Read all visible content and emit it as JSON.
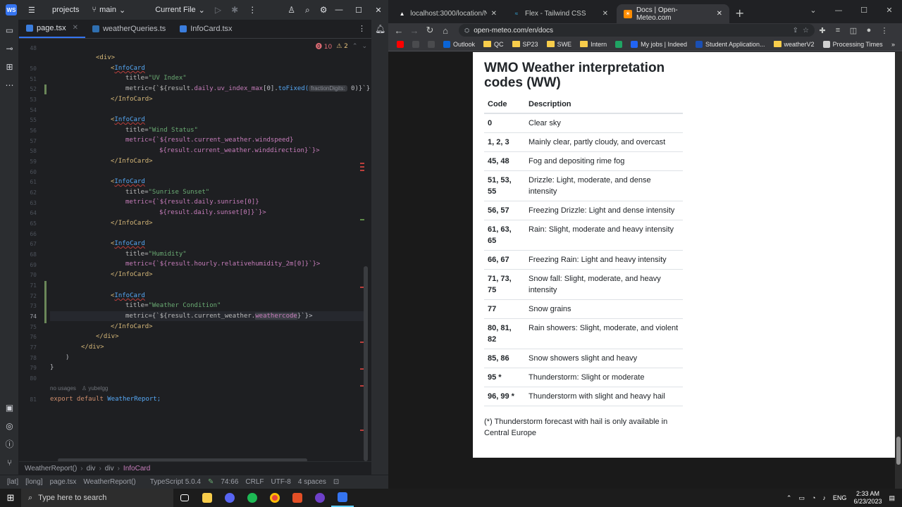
{
  "ide": {
    "project_menu": "projects",
    "branch": "main",
    "run_config": "Current File",
    "tabs": [
      {
        "label": "page.tsx",
        "active": true
      },
      {
        "label": "weatherQueries.ts",
        "active": false
      },
      {
        "label": "InfoCard.tsx",
        "active": false
      }
    ],
    "inspections": {
      "errors": "10",
      "warnings": "2"
    },
    "line_numbers": [
      "48",
      "50",
      "51",
      "52",
      "53",
      "54",
      "55",
      "56",
      "57",
      "58",
      "59",
      "60",
      "61",
      "62",
      "63",
      "64",
      "65",
      "66",
      "67",
      "68",
      "69",
      "70",
      "71",
      "72",
      "73",
      "74",
      "75",
      "76",
      "77",
      "78",
      "79",
      "80",
      "81"
    ],
    "code": {
      "l50": "<div>",
      "infocard": "InfoCard",
      "close_infocard": "</InfoCard>",
      "uv_title_attr": "title=",
      "uv_title": "\"UV Index\"",
      "uv_metric_pre": "metric={`${result.",
      "uv_metric_prop": "daily.uv_index_max",
      "uv_metric_mid": "[0].",
      "uv_metric_fn": "toFixed(",
      "uv_hint": "fractionDigits:",
      "uv_metric_end": " 0)}`}",
      "wind_title": "\"Wind Status\"",
      "wind_m1": "metric={`${result.current_weather.windspeed}",
      "wind_m2": "${result.current_weather.winddirection}`}>",
      "sun_title": "\"Sunrise Sunset\"",
      "sun_m1": "metric={`${result.daily.sunrise[0]}",
      "sun_m2": "${result.daily.sunset[0]}`}>",
      "hum_title": "\"Humidity\"",
      "hum_m1": "metric={`${result.hourly.relativehumidity_2m[0]}`}>",
      "wc_title": "\"Weather Condition\"",
      "wc_m_pre": "metric={`${result.current_weather.",
      "wc_m_hl": "weathercode",
      "wc_m_end": "}`}>",
      "close_div": "</div>",
      "close_paren": ")",
      "close_brace": "}",
      "usages": "no usages",
      "author": "yubelgg",
      "export_kw": "export default",
      "export_name": "WeatherReport;"
    },
    "breadcrumbs": [
      "WeatherReport()",
      "div",
      "div",
      "InfoCard"
    ],
    "status": {
      "left1": "[lat]",
      "left2": "[long]",
      "file": "page.tsx",
      "func": "WeatherReport()",
      "ts_version": "TypeScript 5.0.4",
      "position": "74:66",
      "line_sep": "CRLF",
      "encoding": "UTF-8",
      "indent": "4 spaces"
    }
  },
  "browser": {
    "tabs": [
      {
        "label": "localhost:3000/location/New Yo",
        "active": false
      },
      {
        "label": "Flex - Tailwind CSS",
        "active": false
      },
      {
        "label": "Docs | Open-Meteo.com",
        "active": true
      }
    ],
    "url": "open-meteo.com/en/docs",
    "bookmarks": [
      "Outlook",
      "QC",
      "SP23",
      "SWE",
      "Intern",
      "My jobs | Indeed",
      "Student Application...",
      "weatherV2",
      "Processing Times"
    ],
    "page": {
      "heading": "WMO Weather interpretation codes (WW)",
      "col_code": "Code",
      "col_desc": "Description",
      "rows": [
        {
          "code": "0",
          "desc": "Clear sky"
        },
        {
          "code": "1, 2, 3",
          "desc": "Mainly clear, partly cloudy, and overcast"
        },
        {
          "code": "45, 48",
          "desc": "Fog and depositing rime fog"
        },
        {
          "code": "51, 53, 55",
          "desc": "Drizzle: Light, moderate, and dense intensity"
        },
        {
          "code": "56, 57",
          "desc": "Freezing Drizzle: Light and dense intensity"
        },
        {
          "code": "61, 63, 65",
          "desc": "Rain: Slight, moderate and heavy intensity"
        },
        {
          "code": "66, 67",
          "desc": "Freezing Rain: Light and heavy intensity"
        },
        {
          "code": "71, 73, 75",
          "desc": "Snow fall: Slight, moderate, and heavy intensity"
        },
        {
          "code": "77",
          "desc": "Snow grains"
        },
        {
          "code": "80, 81, 82",
          "desc": "Rain showers: Slight, moderate, and violent"
        },
        {
          "code": "85, 86",
          "desc": "Snow showers slight and heavy"
        },
        {
          "code": "95 *",
          "desc": "Thunderstorm: Slight or moderate"
        },
        {
          "code": "96, 99 *",
          "desc": "Thunderstorm with slight and heavy hail"
        }
      ],
      "footnote": "(*) Thunderstorm forecast with hail is only available in Central Europe"
    }
  },
  "taskbar": {
    "search_placeholder": "Type here to search",
    "language": "ENG",
    "time": "2:33 AM",
    "date": "6/23/2023"
  }
}
